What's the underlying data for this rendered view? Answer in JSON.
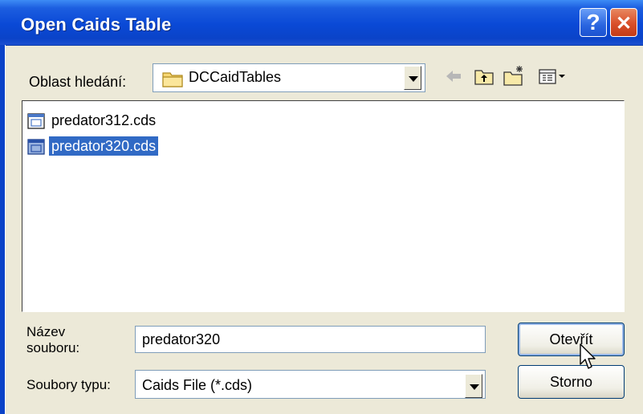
{
  "dialog": {
    "title": "Open Caids Table",
    "help_glyph": "?",
    "close_glyph": "✕"
  },
  "look_in": {
    "label": "Oblast hledání:",
    "folder": "DCCaidTables"
  },
  "toolbar": {
    "icons": [
      "back-arrow-icon",
      "up-folder-icon",
      "new-folder-icon",
      "view-menu-icon"
    ]
  },
  "files": [
    {
      "name": "predator312.cds",
      "selected": false
    },
    {
      "name": "predator320.cds",
      "selected": true
    }
  ],
  "filename": {
    "label_line1": "Název",
    "label_line2": "souboru:",
    "value": "predator320"
  },
  "filetype": {
    "label": "Soubory typu:",
    "value": "Caids File (*.cds)"
  },
  "buttons": {
    "open": "Otevřít",
    "cancel": "Storno"
  },
  "colors": {
    "titlebar": "#0a49d6",
    "selection": "#316ac5",
    "close": "#d94f2a"
  }
}
